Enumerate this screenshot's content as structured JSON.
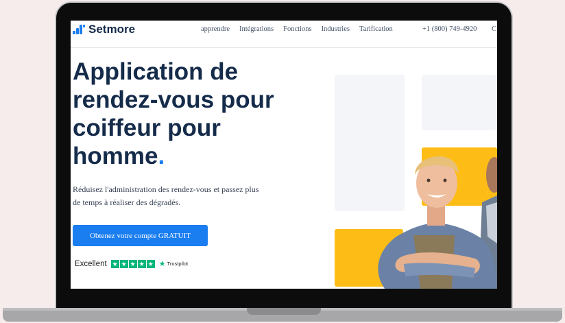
{
  "logo": {
    "text": "Setmore"
  },
  "nav": {
    "items": [
      "apprendre",
      "Intégrations",
      "Fonctions",
      "Industries",
      "Tarification"
    ],
    "phone": "+1 (800) 749-4920",
    "cut_item": "C"
  },
  "hero": {
    "title_lines": [
      "Application de",
      "rendez-vous pour",
      "coiffeur pour",
      "homme"
    ],
    "title_dot": ".",
    "subtitle_line1": "Réduisez l'administration des rendez-vous et passez plus",
    "subtitle_line2": "de temps à réaliser des dégradés.",
    "cta_label": "Obtenez votre compte GRATUIT"
  },
  "trust": {
    "label": "Excellent",
    "brand": "Trustpilot",
    "stars": 5
  },
  "colors": {
    "brand_blue": "#1a7df0",
    "navy": "#152b4a",
    "yellow": "#fdbd16",
    "trust_green": "#00b67a"
  },
  "icons": {
    "logo": "setmore-bars-icon",
    "star": "star-icon"
  }
}
